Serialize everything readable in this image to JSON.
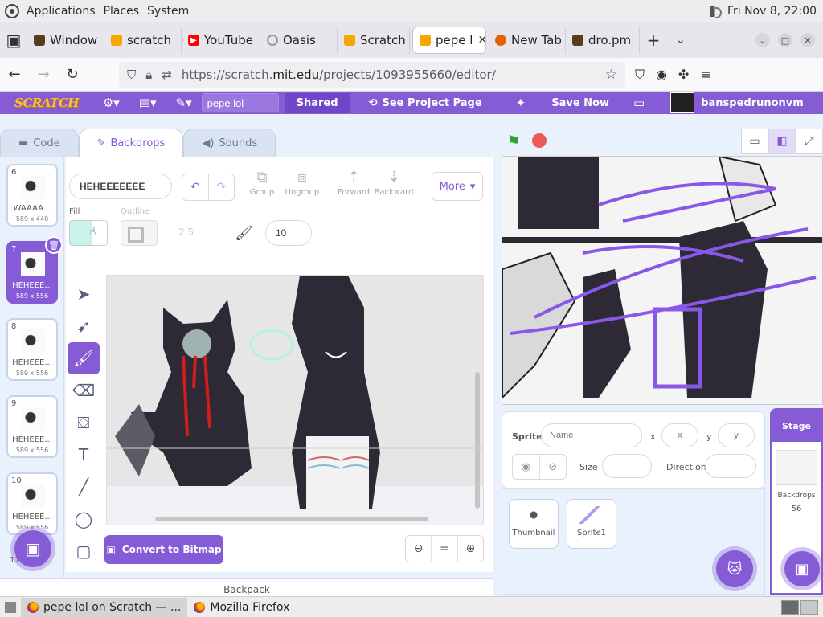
{
  "gnome": {
    "menu": [
      "Applications",
      "Places",
      "System"
    ],
    "clock": "Fri Nov 8, 22:00"
  },
  "tabs": [
    {
      "label": "Window",
      "favicon_color": "#5a3b1e"
    },
    {
      "label": "scratch",
      "favicon_color": "#f7a600"
    },
    {
      "label": "YouTube",
      "favicon_color": "#ff0000"
    },
    {
      "label": "Oasis",
      "favicon_color": "#9a9a9a"
    },
    {
      "label": "Scratch",
      "favicon_color": "#f7a600"
    },
    {
      "label": "pepe l",
      "favicon_color": "#f7a600",
      "active": true
    },
    {
      "label": "New Tab",
      "favicon_color": "#e66000"
    },
    {
      "label": "dro.pm",
      "favicon_color": "#5a3b1e"
    }
  ],
  "browser": {
    "url_prefix": "https://scratch.",
    "url_host": "mit.edu",
    "url_path": "/projects/1093955660/editor/"
  },
  "scratch_menu": {
    "logo": "SCRATCH",
    "project_title": "pepe lol",
    "shared_label": "Shared",
    "see_page_label": "See Project Page",
    "save_label": "Save Now",
    "username": "banspedrunonvm"
  },
  "editor_tabs": {
    "code": "Code",
    "backdrops": "Backdrops",
    "sounds": "Sounds"
  },
  "costumes": [
    {
      "num": "6",
      "name": "WAAAA...",
      "size": "589 x 440"
    },
    {
      "num": "7",
      "name": "HEHEEE...",
      "size": "589 x 556",
      "selected": true
    },
    {
      "num": "8",
      "name": "HEHEEE...",
      "size": "589 x 556"
    },
    {
      "num": "9",
      "name": "HEHEEE...",
      "size": "589 x 556"
    },
    {
      "num": "10",
      "name": "HEHEEE...",
      "size": "589 x 556"
    },
    {
      "num": "11",
      "name": "",
      "size": ""
    }
  ],
  "paint": {
    "costume_name": "HEHEEEEEEE",
    "group": "Group",
    "ungroup": "Ungroup",
    "forward": "Forward",
    "backward": "Backward",
    "more": "More",
    "fill_label": "Fill",
    "outline_label": "Outline",
    "outline_width": "2.5",
    "brush_size": "10",
    "convert_label": "Convert to Bitmap",
    "fill_color": "#c9f3e8"
  },
  "backpack_label": "Backpack",
  "sprite_info": {
    "sprite_label": "Sprite",
    "name_placeholder": "Name",
    "x_label": "x",
    "x_placeholder": "x",
    "y_label": "y",
    "y_placeholder": "y",
    "size_label": "Size",
    "direction_label": "Direction"
  },
  "sprites": [
    {
      "name": "Thumbnail"
    },
    {
      "name": "Sprite1"
    }
  ],
  "stage_pane": {
    "title": "Stage",
    "backdrops_label": "Backdrops",
    "backdrops_count": "56"
  },
  "taskbar": {
    "item1": "pepe lol on Scratch — ...",
    "item2": "Mozilla Firefox"
  },
  "colors": {
    "scratch_purple": "#855cd6",
    "gnome_panel": "#ededed"
  }
}
